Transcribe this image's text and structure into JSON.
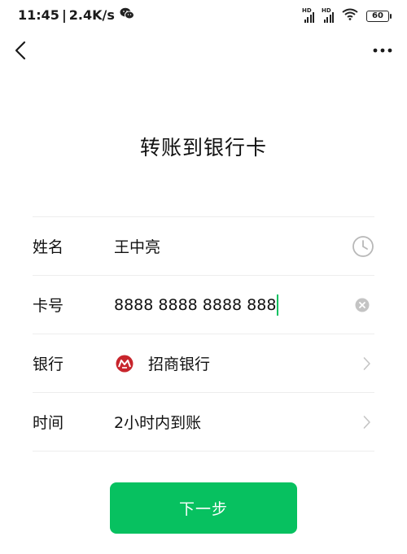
{
  "status_bar": {
    "time": "11:45",
    "separator": "|",
    "speed": "2.4K/s",
    "hd1": "HD",
    "hd2": "HD",
    "battery": "60"
  },
  "header": {
    "title": "转账到银行卡"
  },
  "form": {
    "name": {
      "label": "姓名",
      "value": "王中亮"
    },
    "card": {
      "label": "卡号",
      "value": "8888 8888 8888 888"
    },
    "bank": {
      "label": "银行",
      "value": "招商银行"
    },
    "time": {
      "label": "时间",
      "value": "2小时内到账"
    }
  },
  "actions": {
    "next_label": "下一步"
  },
  "colors": {
    "accent": "#07c160",
    "bank_logo": "#c8252c"
  }
}
